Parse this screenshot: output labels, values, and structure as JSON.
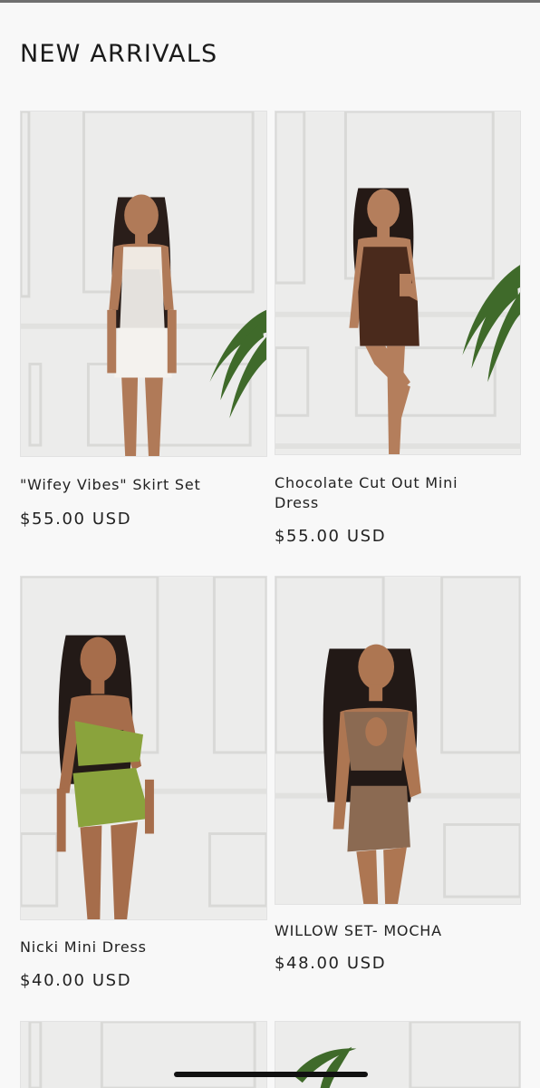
{
  "section": {
    "title": "NEW ARRIVALS"
  },
  "products": [
    {
      "name": "\"Wifey Vibes\" Skirt Set",
      "price": "$55.00 USD",
      "outfit_color": "#f4f2ee",
      "skin": "#b07a58"
    },
    {
      "name": "Chocolate Cut Out Mini Dress",
      "price": "$55.00 USD",
      "outfit_color": "#4a2a1c",
      "skin": "#b47e5c"
    },
    {
      "name": "Nicki Mini Dress",
      "price": "$40.00 USD",
      "outfit_color": "#8aa33c",
      "skin": "#a66d4b"
    },
    {
      "name": "WILLOW SET- MOCHA",
      "price": "$48.00 USD",
      "outfit_color": "#8b6a52",
      "skin": "#ad7652"
    }
  ],
  "colors": {
    "background": "#f8f8f8",
    "wall": "#ebebea",
    "plant": "#3f6a2a"
  }
}
